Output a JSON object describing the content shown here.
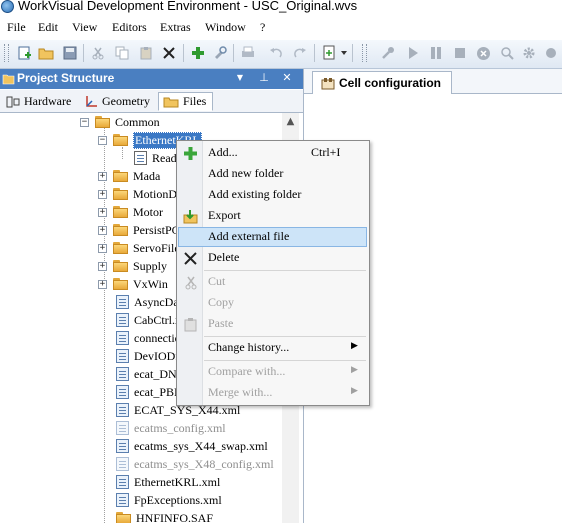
{
  "window": {
    "title": "WorkVisual Development Environment - USC_Original.wvs"
  },
  "menu": [
    "File",
    "Edit",
    "View",
    "Editors",
    "Extras",
    "Window",
    "?"
  ],
  "toolbar": {
    "icons": [
      "new-project-icon",
      "open-icon",
      "save-icon",
      "cut-icon",
      "copy-icon",
      "paste-icon",
      "delete-icon",
      "add-icon",
      "settings-icon",
      "print-icon",
      "undo-icon",
      "redo-icon",
      "compare-icon",
      "dropdown-icon",
      "wrench-icon",
      "play-icon",
      "pause-icon",
      "stop-icon",
      "cancel-icon",
      "search-icon",
      "gear-icon",
      "record-icon"
    ]
  },
  "project_panel": {
    "title": "Project Structure",
    "pin_glyph": "⊥",
    "close_glyph": "✕",
    "dropdown_glyph": "▼",
    "tabs": [
      "Hardware",
      "Geometry",
      "Files"
    ]
  },
  "tree": {
    "root": "Common",
    "items": [
      {
        "label": "EthernetKRL",
        "type": "folder",
        "expanded": true
      },
      {
        "label": "ReadMe",
        "type": "file"
      },
      {
        "label": "Mada",
        "type": "folder"
      },
      {
        "label": "MotionDef",
        "type": "folder"
      },
      {
        "label": "Motor",
        "type": "folder"
      },
      {
        "label": "PersistPCI",
        "type": "folder"
      },
      {
        "label": "ServoFiles",
        "type": "folder"
      },
      {
        "label": "Supply",
        "type": "folder"
      },
      {
        "label": "VxWin",
        "type": "folder"
      },
      {
        "label": "AsyncDataCtrl",
        "type": "file"
      },
      {
        "label": "CabCtrl.xml",
        "type": "file"
      },
      {
        "label": "connection",
        "type": "file"
      },
      {
        "label": "DevIODriver",
        "type": "file"
      },
      {
        "label": "ecat_DNI",
        "type": "file"
      },
      {
        "label": "ecat_PBM",
        "type": "file"
      },
      {
        "label": "ECAT_SYS_X44.xml",
        "type": "file"
      },
      {
        "label": "ecatms_config.xml",
        "type": "file",
        "grey": true
      },
      {
        "label": "ecatms_sys_X44_swap.xml",
        "type": "file"
      },
      {
        "label": "ecatms_sys_X48_config.xml",
        "type": "file",
        "grey": true
      },
      {
        "label": "EthernetKRL.xml",
        "type": "file"
      },
      {
        "label": "FpExceptions.xml",
        "type": "file"
      },
      {
        "label": "HNFINFO.SAF",
        "type": "folderfile"
      }
    ]
  },
  "document": {
    "tab_label": "Cell configuration"
  },
  "context_menu": {
    "items": [
      {
        "label": "Add...",
        "shortcut": "Ctrl+I",
        "icon": "plus-icon"
      },
      {
        "label": "Add new folder"
      },
      {
        "label": "Add existing folder"
      },
      {
        "label": "Export",
        "icon": "export-icon"
      },
      {
        "label": "Add external file",
        "highlighted": true
      },
      {
        "label": "Delete",
        "icon": "delete-x-icon"
      },
      {
        "label": "Cut",
        "disabled": true,
        "icon": "scissors-icon"
      },
      {
        "label": "Copy",
        "disabled": true,
        "icon": "copy-icon"
      },
      {
        "label": "Paste",
        "disabled": true,
        "icon": "paste-icon"
      },
      {
        "label": "Change history...",
        "submenu": true
      },
      {
        "label": "Compare with...",
        "submenu": true,
        "disabled": true
      },
      {
        "label": "Merge with...",
        "submenu": true,
        "disabled": true
      }
    ],
    "submenu_glyph": "▶"
  },
  "colors": {
    "panel_header": "#4a7fc1",
    "highlight": "#cde4f8",
    "folder": "#e8a93a"
  }
}
